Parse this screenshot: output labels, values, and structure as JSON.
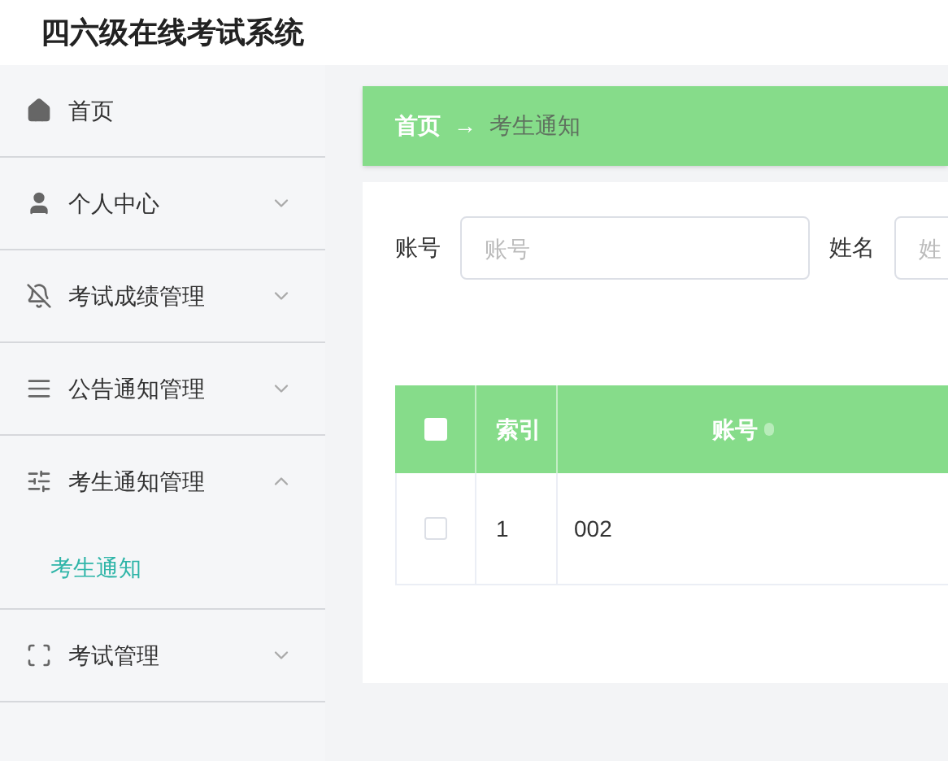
{
  "header": {
    "title": "四六级在线考试系统"
  },
  "sidebar": {
    "items": [
      {
        "label": "首页"
      },
      {
        "label": "个人中心",
        "expanded": false
      },
      {
        "label": "考试成绩管理",
        "expanded": false
      },
      {
        "label": "公告通知管理",
        "expanded": false
      },
      {
        "label": "考生通知管理",
        "expanded": true,
        "children": [
          {
            "label": "考生通知",
            "selected": true
          }
        ]
      },
      {
        "label": "考试管理",
        "expanded": false
      }
    ]
  },
  "breadcrumb": {
    "home": "首页",
    "separator": "→",
    "current": "考生通知"
  },
  "search": {
    "fields": [
      {
        "label": "账号",
        "placeholder": "账号"
      },
      {
        "label": "姓名",
        "placeholder": "姓"
      }
    ]
  },
  "table": {
    "select_all_checked": false,
    "columns": [
      {
        "label": "索引",
        "sortable": false
      },
      {
        "label": "账号",
        "sortable": true
      }
    ],
    "rows": [
      {
        "checked": false,
        "cells": [
          "1",
          "002"
        ]
      }
    ]
  }
}
